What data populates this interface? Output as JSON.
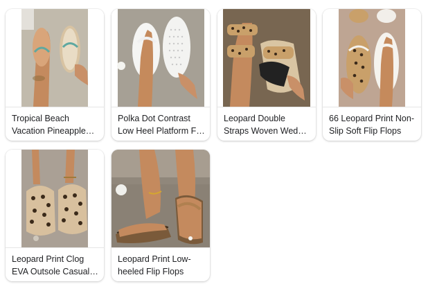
{
  "products": [
    {
      "title": "Tropical Beach Vacation Pineapple Decor Flip Flops"
    },
    {
      "title": "Polka Dot Contrast Low Heel Platform Flip Flops"
    },
    {
      "title": "Leopard Double Straps Woven Wedge Sandals"
    },
    {
      "title": "66 Leopard Print Non-Slip Soft Flip Flops"
    },
    {
      "title": "Leopard Print Clog EVA Outsole Casual Sandals"
    },
    {
      "title": "Leopard Print Low-heeled Flip Flops"
    }
  ],
  "colors": {
    "card_bg": "#ffffff",
    "text": "#202124",
    "divider": "#e6e6e6"
  }
}
